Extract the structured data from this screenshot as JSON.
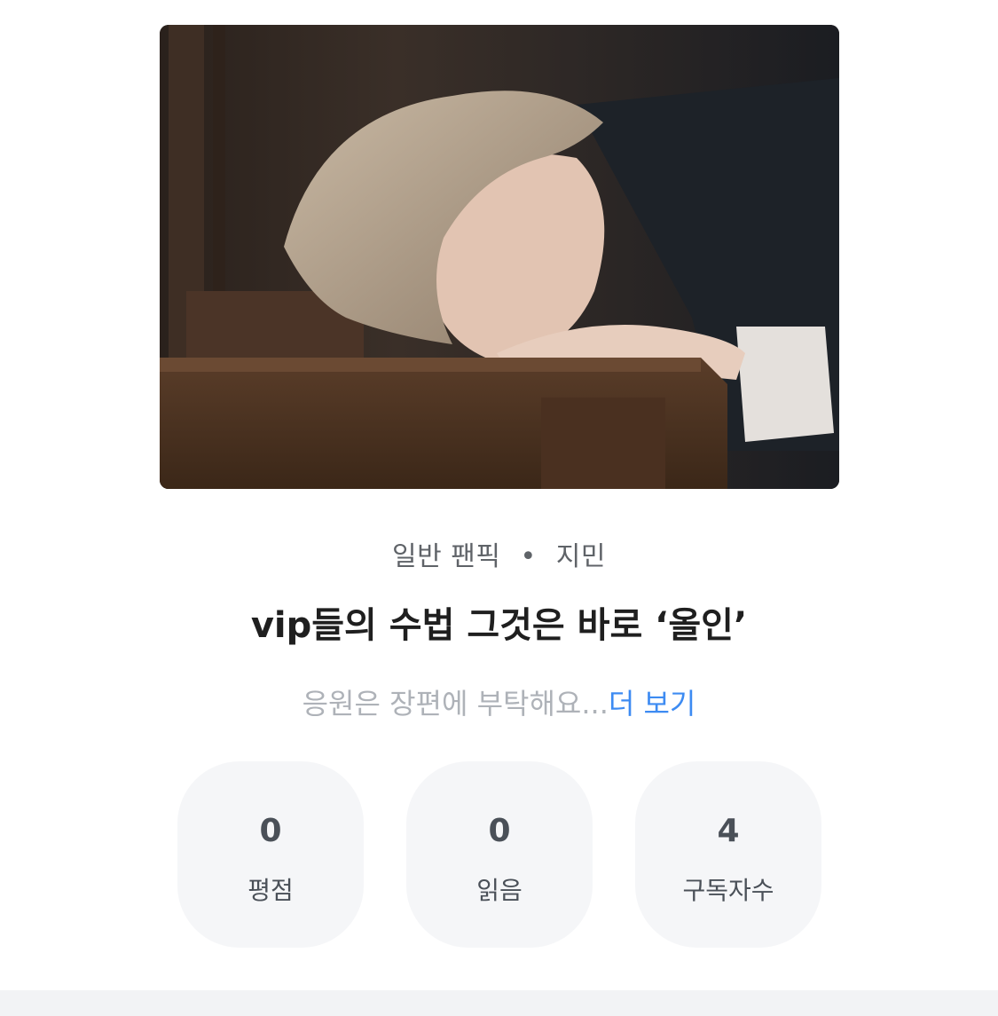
{
  "work": {
    "genre": "일반 팬픽",
    "separator": "•",
    "character": "지민",
    "title": "vip들의 수법 그것은 바로 ‘올인’",
    "description": "응원은 장편에 부탁해요...",
    "more_label": "더 보기"
  },
  "stats": [
    {
      "value": "0",
      "label": "평점"
    },
    {
      "value": "0",
      "label": "읽음"
    },
    {
      "value": "4",
      "label": "구독자수"
    }
  ],
  "colors": {
    "link": "#3d8bf2",
    "stat_bg": "#f5f6f8",
    "title": "#1f1f1f"
  }
}
